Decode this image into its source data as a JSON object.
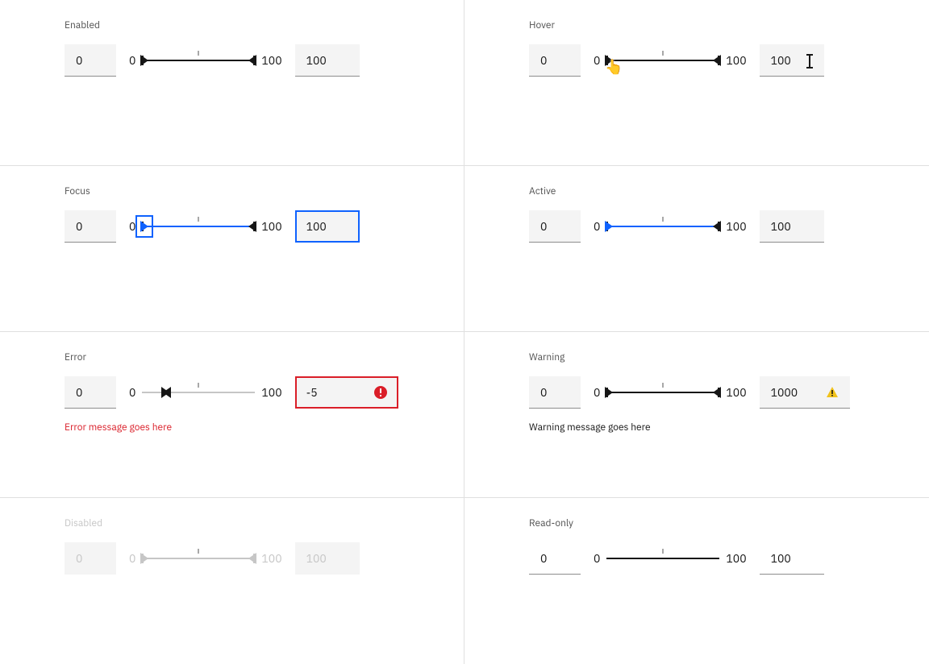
{
  "states": {
    "enabled": {
      "label": "Enabled",
      "min_value": "0",
      "min_tick": "0",
      "max_tick": "100",
      "max_value": "100"
    },
    "hover": {
      "label": "Hover",
      "min_value": "0",
      "min_tick": "0",
      "max_tick": "100",
      "max_value": "100"
    },
    "focus": {
      "label": "Focus",
      "min_value": "0",
      "min_tick": "0",
      "max_tick": "100",
      "max_value": "100"
    },
    "active": {
      "label": "Active",
      "min_value": "0",
      "min_tick": "0",
      "max_tick": "100",
      "max_value": "100"
    },
    "error": {
      "label": "Error",
      "min_value": "0",
      "min_tick": "0",
      "max_tick": "100",
      "max_value": "-5",
      "message": "Error message goes here"
    },
    "warning": {
      "label": "Warning",
      "min_value": "0",
      "min_tick": "0",
      "max_tick": "100",
      "max_value": "1000",
      "message": "Warning message goes here"
    },
    "disabled": {
      "label": "Disabled",
      "min_value": "0",
      "min_tick": "0",
      "max_tick": "100",
      "max_value": "100"
    },
    "readonly": {
      "label": "Read-only",
      "min_value": "0",
      "min_tick": "0",
      "max_tick": "100",
      "max_value": "100"
    }
  },
  "colors": {
    "focus": "#0f62fe",
    "error": "#da1e28",
    "warning": "#f1c21b",
    "field_bg": "#f4f4f4",
    "text": "#161616",
    "text_secondary": "#525252",
    "disabled": "#c6c6c6"
  }
}
